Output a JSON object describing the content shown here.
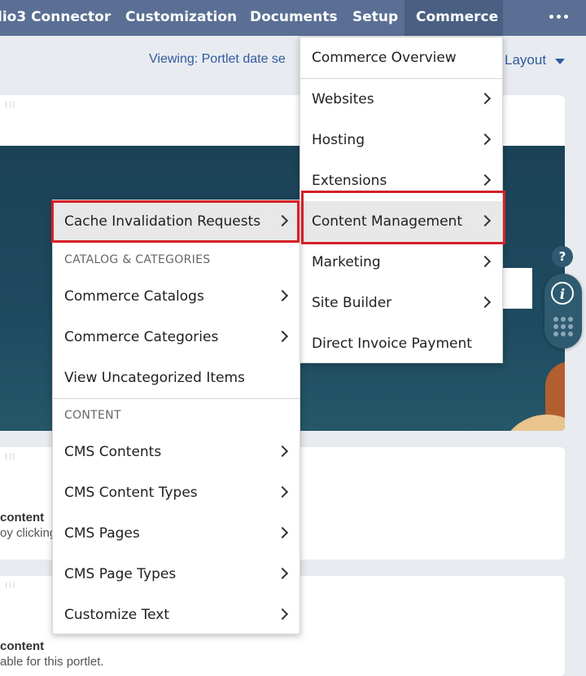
{
  "topbar": {
    "items": [
      "lio3 Connector",
      "Customization",
      "Documents",
      "Setup",
      "Commerce"
    ],
    "active": "Commerce",
    "more_icon": "ellipsis-icon"
  },
  "viewing": {
    "text": "Viewing: Portlet date se",
    "layout_label": "Layout"
  },
  "cards": {
    "card2": {
      "title": "content",
      "text": "oy clicking"
    },
    "card3": {
      "title": "content",
      "text": "able for this portlet."
    }
  },
  "side_widget": {
    "help": "?",
    "info": "i"
  },
  "commerce_menu": {
    "items": [
      {
        "label": "Commerce Overview",
        "submenu": false
      },
      {
        "label": "Websites",
        "submenu": true
      },
      {
        "label": "Hosting",
        "submenu": true
      },
      {
        "label": "Extensions",
        "submenu": true
      },
      {
        "label": "Content Management",
        "submenu": true,
        "highlighted": true
      },
      {
        "label": "Marketing",
        "submenu": true
      },
      {
        "label": "Site Builder",
        "submenu": true
      },
      {
        "label": "Direct Invoice Payment",
        "submenu": false
      }
    ]
  },
  "content_menu": {
    "top_item": "Cache Invalidation Requests",
    "section1": "CATALOG & CATEGORIES",
    "section1_items": [
      "Commerce Catalogs",
      "Commerce Categories",
      "View Uncategorized Items"
    ],
    "section2": "CONTENT",
    "section2_items": [
      "CMS Contents",
      "CMS Content Types",
      "CMS Pages",
      "CMS Page Types",
      "Customize Text"
    ]
  },
  "colors": {
    "topbar": "#5a6f93",
    "highlight_box": "#d62027",
    "link": "#2f5a9c"
  }
}
